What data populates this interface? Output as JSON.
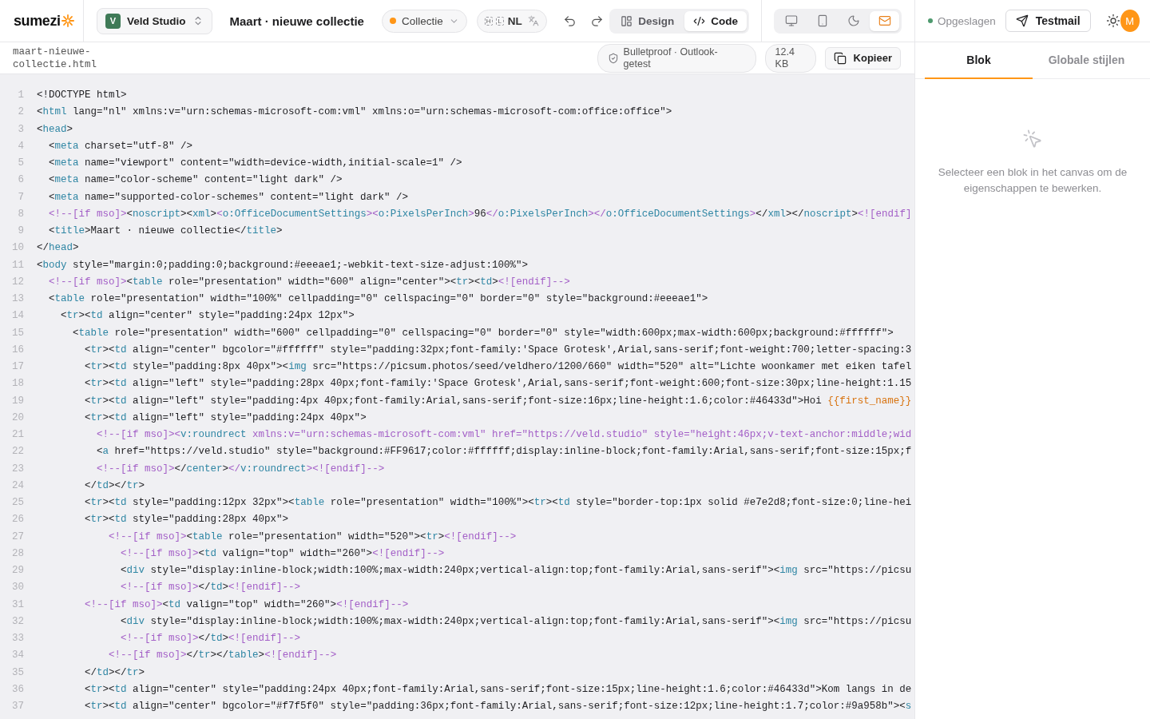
{
  "topbar": {
    "logo": "sumezi",
    "workspace": {
      "initial": "V",
      "name": "Veld Studio"
    },
    "document_title": "Maart · nieuwe collectie",
    "collection": "Collectie",
    "language": {
      "keys": [
        "H",
        "L"
      ],
      "label": "NL"
    },
    "view_modes": [
      {
        "kind": "design",
        "label": "Design",
        "selected": false
      },
      {
        "kind": "code",
        "label": "Code",
        "selected": true
      }
    ],
    "previews": [
      {
        "kind": "desktop",
        "selected": false
      },
      {
        "kind": "mobile",
        "selected": false
      },
      {
        "kind": "dark",
        "selected": false
      },
      {
        "kind": "email",
        "selected": true
      }
    ],
    "save_status": "Opgeslagen",
    "test_button": "Testmail",
    "avatar": "M"
  },
  "code_view": {
    "file_name": "maart-nieuwe-collectie.html",
    "compat_badge": "Bulletproof · Outlook-getest",
    "size_badge": "12.4 KB",
    "copy_button": "Kopieer",
    "lines": [
      {
        "number": "1",
        "tokens": [
          {
            "kind": "text",
            "text": "<!DOCTYPE html>"
          }
        ]
      },
      {
        "number": "2",
        "tokens": [
          {
            "kind": "text",
            "text": "<"
          },
          {
            "kind": "tag",
            "text": "html"
          },
          {
            "kind": "text",
            "text": " lang=\"nl\" xmlns:v=\"urn:schemas-microsoft-com:vml\" xmlns:o=\"urn:schemas-microsoft-com:office:office\">"
          }
        ]
      },
      {
        "number": "3",
        "tokens": [
          {
            "kind": "text",
            "text": "<"
          },
          {
            "kind": "tag",
            "text": "head"
          },
          {
            "kind": "text",
            "text": ">"
          }
        ]
      },
      {
        "number": "4",
        "tokens": [
          {
            "kind": "text",
            "text": "  <"
          },
          {
            "kind": "tag",
            "text": "meta"
          },
          {
            "kind": "text",
            "text": " charset=\"utf-8\" />"
          }
        ]
      },
      {
        "number": "5",
        "tokens": [
          {
            "kind": "text",
            "text": "  <"
          },
          {
            "kind": "tag",
            "text": "meta"
          },
          {
            "kind": "text",
            "text": " name=\"viewport\" content=\"width=device-width,initial-scale=1\" />"
          }
        ]
      },
      {
        "number": "6",
        "tokens": [
          {
            "kind": "text",
            "text": "  <"
          },
          {
            "kind": "tag",
            "text": "meta"
          },
          {
            "kind": "text",
            "text": " name=\"color-scheme\" content=\"light dark\" />"
          }
        ]
      },
      {
        "number": "7",
        "tokens": [
          {
            "kind": "text",
            "text": "  <"
          },
          {
            "kind": "tag",
            "text": "meta"
          },
          {
            "kind": "text",
            "text": " name=\"supported-color-schemes\" content=\"light dark\" />"
          }
        ]
      },
      {
        "number": "8",
        "tokens": [
          {
            "kind": "comment",
            "text": "  <!--[if mso]>"
          },
          {
            "kind": "text",
            "text": "<"
          },
          {
            "kind": "tag",
            "text": "noscript"
          },
          {
            "kind": "text",
            "text": "><"
          },
          {
            "kind": "tag",
            "text": "xml"
          },
          {
            "kind": "text",
            "text": ">"
          },
          {
            "kind": "comment",
            "text": "<"
          },
          {
            "kind": "tag",
            "text": "o:OfficeDocumentSettings"
          },
          {
            "kind": "comment",
            "text": "><"
          },
          {
            "kind": "tag",
            "text": "o:PixelsPerInch"
          },
          {
            "kind": "comment",
            "text": ">"
          },
          {
            "kind": "text",
            "text": "96"
          },
          {
            "kind": "comment",
            "text": "</"
          },
          {
            "kind": "tag",
            "text": "o:PixelsPerInch"
          },
          {
            "kind": "comment",
            "text": "></"
          },
          {
            "kind": "tag",
            "text": "o:OfficeDocumentSettings"
          },
          {
            "kind": "comment",
            "text": ">"
          },
          {
            "kind": "text",
            "text": "</"
          },
          {
            "kind": "tag",
            "text": "xml"
          },
          {
            "kind": "text",
            "text": "></"
          },
          {
            "kind": "tag",
            "text": "noscript"
          },
          {
            "kind": "text",
            "text": ">"
          },
          {
            "kind": "comment",
            "text": "<![endif]"
          }
        ]
      },
      {
        "number": "9",
        "tokens": [
          {
            "kind": "text",
            "text": "  <"
          },
          {
            "kind": "tag",
            "text": "title"
          },
          {
            "kind": "text",
            "text": ">Maart · nieuwe collectie</"
          },
          {
            "kind": "tag",
            "text": "title"
          },
          {
            "kind": "text",
            "text": ">"
          }
        ]
      },
      {
        "number": "10",
        "tokens": [
          {
            "kind": "text",
            "text": "</"
          },
          {
            "kind": "tag",
            "text": "head"
          },
          {
            "kind": "text",
            "text": ">"
          }
        ]
      },
      {
        "number": "11",
        "tokens": [
          {
            "kind": "text",
            "text": "<"
          },
          {
            "kind": "tag",
            "text": "body"
          },
          {
            "kind": "text",
            "text": " style=\"margin:0;padding:0;background:#eeeae1;-webkit-text-size-adjust:100%\">"
          }
        ]
      },
      {
        "number": "12",
        "tokens": [
          {
            "kind": "comment",
            "text": "  <!--[if mso]>"
          },
          {
            "kind": "text",
            "text": "<"
          },
          {
            "kind": "tag",
            "text": "table"
          },
          {
            "kind": "text",
            "text": " role=\"presentation\" width=\"600\" align=\"center\"><"
          },
          {
            "kind": "tag",
            "text": "tr"
          },
          {
            "kind": "text",
            "text": "><"
          },
          {
            "kind": "tag",
            "text": "td"
          },
          {
            "kind": "text",
            "text": ">"
          },
          {
            "kind": "comment",
            "text": "<![endif]-->"
          }
        ]
      },
      {
        "number": "13",
        "tokens": [
          {
            "kind": "text",
            "text": "  <"
          },
          {
            "kind": "tag",
            "text": "table"
          },
          {
            "kind": "text",
            "text": " role=\"presentation\" width=\"100%\" cellpadding=\"0\" cellspacing=\"0\" border=\"0\" style=\"background:#eeeae1\">"
          }
        ]
      },
      {
        "number": "14",
        "tokens": [
          {
            "kind": "text",
            "text": "    <"
          },
          {
            "kind": "tag",
            "text": "tr"
          },
          {
            "kind": "text",
            "text": "><"
          },
          {
            "kind": "tag",
            "text": "td"
          },
          {
            "kind": "text",
            "text": " align=\"center\" style=\"padding:24px 12px\">"
          }
        ]
      },
      {
        "number": "15",
        "tokens": [
          {
            "kind": "text",
            "text": "      <"
          },
          {
            "kind": "tag",
            "text": "table"
          },
          {
            "kind": "text",
            "text": " role=\"presentation\" width=\"600\" cellpadding=\"0\" cellspacing=\"0\" border=\"0\" style=\"width:600px;max-width:600px;background:#ffffff\">"
          }
        ]
      },
      {
        "number": "16",
        "tokens": [
          {
            "kind": "text",
            "text": "        <"
          },
          {
            "kind": "tag",
            "text": "tr"
          },
          {
            "kind": "text",
            "text": "><"
          },
          {
            "kind": "tag",
            "text": "td"
          },
          {
            "kind": "text",
            "text": " align=\"center\" bgcolor=\"#ffffff\" style=\"padding:32px;font-family:'Space Grotesk',Arial,sans-serif;font-weight:700;letter-spacing:3"
          }
        ]
      },
      {
        "number": "17",
        "tokens": [
          {
            "kind": "text",
            "text": "        <"
          },
          {
            "kind": "tag",
            "text": "tr"
          },
          {
            "kind": "text",
            "text": "><"
          },
          {
            "kind": "tag",
            "text": "td"
          },
          {
            "kind": "text",
            "text": " style=\"padding:8px 40px\"><"
          },
          {
            "kind": "tag",
            "text": "img"
          },
          {
            "kind": "text",
            "text": " src=\"https://picsum.photos/seed/veldhero/1200/660\" width=\"520\" alt=\"Lichte woonkamer met eiken tafel"
          }
        ]
      },
      {
        "number": "18",
        "tokens": [
          {
            "kind": "text",
            "text": "        <"
          },
          {
            "kind": "tag",
            "text": "tr"
          },
          {
            "kind": "text",
            "text": "><"
          },
          {
            "kind": "tag",
            "text": "td"
          },
          {
            "kind": "text",
            "text": " align=\"left\" style=\"padding:28px 40px;font-family:'Space Grotesk',Arial,sans-serif;font-weight:600;font-size:30px;line-height:1.15"
          }
        ]
      },
      {
        "number": "19",
        "tokens": [
          {
            "kind": "text",
            "text": "        <"
          },
          {
            "kind": "tag",
            "text": "tr"
          },
          {
            "kind": "text",
            "text": "><"
          },
          {
            "kind": "tag",
            "text": "td"
          },
          {
            "kind": "text",
            "text": " align=\"left\" style=\"padding:4px 40px;font-family:Arial,sans-serif;font-size:16px;line-height:1.6;color:#46433d\">Hoi "
          },
          {
            "kind": "var",
            "text": "{{first_name}}"
          }
        ]
      },
      {
        "number": "20",
        "tokens": [
          {
            "kind": "text",
            "text": "        <"
          },
          {
            "kind": "tag",
            "text": "tr"
          },
          {
            "kind": "text",
            "text": "><"
          },
          {
            "kind": "tag",
            "text": "td"
          },
          {
            "kind": "text",
            "text": " align=\"left\" style=\"padding:24px 40px\">"
          }
        ]
      },
      {
        "number": "21",
        "tokens": [
          {
            "kind": "comment",
            "text": "          <!--[if mso]><"
          },
          {
            "kind": "tag",
            "text": "v:roundrect"
          },
          {
            "kind": "comment",
            "text": " xmlns:v=\"urn:schemas-microsoft-com:vml\" href=\"https://veld.studio\" style=\"height:46px;v-text-anchor:middle;wid"
          }
        ]
      },
      {
        "number": "22",
        "tokens": [
          {
            "kind": "text",
            "text": "          <"
          },
          {
            "kind": "tag",
            "text": "a"
          },
          {
            "kind": "text",
            "text": " href=\"https://veld.studio\" style=\"background:#FF9617;color:#ffffff;display:inline-block;font-family:Arial,sans-serif;font-size:15px;f"
          }
        ]
      },
      {
        "number": "23",
        "tokens": [
          {
            "kind": "comment",
            "text": "          <!--[if mso]>"
          },
          {
            "kind": "text",
            "text": "</"
          },
          {
            "kind": "tag",
            "text": "center"
          },
          {
            "kind": "text",
            "text": ">"
          },
          {
            "kind": "comment",
            "text": "</"
          },
          {
            "kind": "tag",
            "text": "v:roundrect"
          },
          {
            "kind": "comment",
            "text": "><![endif]-->"
          }
        ]
      },
      {
        "number": "24",
        "tokens": [
          {
            "kind": "text",
            "text": "        </"
          },
          {
            "kind": "tag",
            "text": "td"
          },
          {
            "kind": "text",
            "text": "></"
          },
          {
            "kind": "tag",
            "text": "tr"
          },
          {
            "kind": "text",
            "text": ">"
          }
        ]
      },
      {
        "number": "25",
        "tokens": [
          {
            "kind": "text",
            "text": "        <"
          },
          {
            "kind": "tag",
            "text": "tr"
          },
          {
            "kind": "text",
            "text": "><"
          },
          {
            "kind": "tag",
            "text": "td"
          },
          {
            "kind": "text",
            "text": " style=\"padding:12px 32px\"><"
          },
          {
            "kind": "tag",
            "text": "table"
          },
          {
            "kind": "text",
            "text": " role=\"presentation\" width=\"100%\"><"
          },
          {
            "kind": "tag",
            "text": "tr"
          },
          {
            "kind": "text",
            "text": "><"
          },
          {
            "kind": "tag",
            "text": "td"
          },
          {
            "kind": "text",
            "text": " style=\"border-top:1px solid #e7e2d8;font-size:0;line-hei"
          }
        ]
      },
      {
        "number": "26",
        "tokens": [
          {
            "kind": "text",
            "text": "        <"
          },
          {
            "kind": "tag",
            "text": "tr"
          },
          {
            "kind": "text",
            "text": "><"
          },
          {
            "kind": "tag",
            "text": "td"
          },
          {
            "kind": "text",
            "text": " style=\"padding:28px 40px\">"
          }
        ]
      },
      {
        "number": "27",
        "tokens": [
          {
            "kind": "comment",
            "text": "            <!--[if mso]>"
          },
          {
            "kind": "text",
            "text": "<"
          },
          {
            "kind": "tag",
            "text": "table"
          },
          {
            "kind": "text",
            "text": " role=\"presentation\" width=\"520\"><"
          },
          {
            "kind": "tag",
            "text": "tr"
          },
          {
            "kind": "text",
            "text": ">"
          },
          {
            "kind": "comment",
            "text": "<![endif]-->"
          }
        ]
      },
      {
        "number": "28",
        "tokens": [
          {
            "kind": "comment",
            "text": "              <!--[if mso]>"
          },
          {
            "kind": "text",
            "text": "<"
          },
          {
            "kind": "tag",
            "text": "td"
          },
          {
            "kind": "text",
            "text": " valign=\"top\" width=\"260\">"
          },
          {
            "kind": "comment",
            "text": "<![endif]-->"
          }
        ]
      },
      {
        "number": "29",
        "tokens": [
          {
            "kind": "text",
            "text": "              <"
          },
          {
            "kind": "tag",
            "text": "div"
          },
          {
            "kind": "text",
            "text": " style=\"display:inline-block;width:100%;max-width:240px;vertical-align:top;font-family:Arial,sans-serif\"><"
          },
          {
            "kind": "tag",
            "text": "img"
          },
          {
            "kind": "text",
            "text": " src=\"https://picsu"
          }
        ]
      },
      {
        "number": "30",
        "tokens": [
          {
            "kind": "comment",
            "text": "              <!--[if mso]>"
          },
          {
            "kind": "text",
            "text": "</"
          },
          {
            "kind": "tag",
            "text": "td"
          },
          {
            "kind": "text",
            "text": ">"
          },
          {
            "kind": "comment",
            "text": "<![endif]-->"
          }
        ]
      },
      {
        "number": "31",
        "tokens": [
          {
            "kind": "comment",
            "text": "        <!--[if mso]>"
          },
          {
            "kind": "text",
            "text": "<"
          },
          {
            "kind": "tag",
            "text": "td"
          },
          {
            "kind": "text",
            "text": " valign=\"top\" width=\"260\">"
          },
          {
            "kind": "comment",
            "text": "<![endif]-->"
          }
        ]
      },
      {
        "number": "32",
        "tokens": [
          {
            "kind": "text",
            "text": "              <"
          },
          {
            "kind": "tag",
            "text": "div"
          },
          {
            "kind": "text",
            "text": " style=\"display:inline-block;width:100%;max-width:240px;vertical-align:top;font-family:Arial,sans-serif\"><"
          },
          {
            "kind": "tag",
            "text": "img"
          },
          {
            "kind": "text",
            "text": " src=\"https://picsu"
          }
        ]
      },
      {
        "number": "33",
        "tokens": [
          {
            "kind": "comment",
            "text": "              <!--[if mso]>"
          },
          {
            "kind": "text",
            "text": "</"
          },
          {
            "kind": "tag",
            "text": "td"
          },
          {
            "kind": "text",
            "text": ">"
          },
          {
            "kind": "comment",
            "text": "<![endif]-->"
          }
        ]
      },
      {
        "number": "34",
        "tokens": [
          {
            "kind": "comment",
            "text": "            <!--[if mso]>"
          },
          {
            "kind": "text",
            "text": "</"
          },
          {
            "kind": "tag",
            "text": "tr"
          },
          {
            "kind": "text",
            "text": "></"
          },
          {
            "kind": "tag",
            "text": "table"
          },
          {
            "kind": "text",
            "text": ">"
          },
          {
            "kind": "comment",
            "text": "<![endif]-->"
          }
        ]
      },
      {
        "number": "35",
        "tokens": [
          {
            "kind": "text",
            "text": "        </"
          },
          {
            "kind": "tag",
            "text": "td"
          },
          {
            "kind": "text",
            "text": "></"
          },
          {
            "kind": "tag",
            "text": "tr"
          },
          {
            "kind": "text",
            "text": ">"
          }
        ]
      },
      {
        "number": "36",
        "tokens": [
          {
            "kind": "text",
            "text": "        <"
          },
          {
            "kind": "tag",
            "text": "tr"
          },
          {
            "kind": "text",
            "text": "><"
          },
          {
            "kind": "tag",
            "text": "td"
          },
          {
            "kind": "text",
            "text": " align=\"center\" style=\"padding:24px 40px;font-family:Arial,sans-serif;font-size:15px;line-height:1.6;color:#46433d\">Kom langs in de"
          }
        ]
      },
      {
        "number": "37",
        "tokens": [
          {
            "kind": "text",
            "text": "        <"
          },
          {
            "kind": "tag",
            "text": "tr"
          },
          {
            "kind": "text",
            "text": "><"
          },
          {
            "kind": "tag",
            "text": "td"
          },
          {
            "kind": "text",
            "text": " align=\"center\" bgcolor=\"#f7f5f0\" style=\"padding:36px;font-family:Arial,sans-serif;font-size:12px;line-height:1.7;color:#9a958b\"><"
          },
          {
            "kind": "tag",
            "text": "s"
          }
        ]
      }
    ]
  },
  "inspector": {
    "tabs": [
      {
        "label": "Blok",
        "selected": true
      },
      {
        "label": "Globale stijlen",
        "selected": false
      }
    ],
    "empty_message": "Selecteer een blok in het canvas om de eigenschappen te bewerken."
  }
}
